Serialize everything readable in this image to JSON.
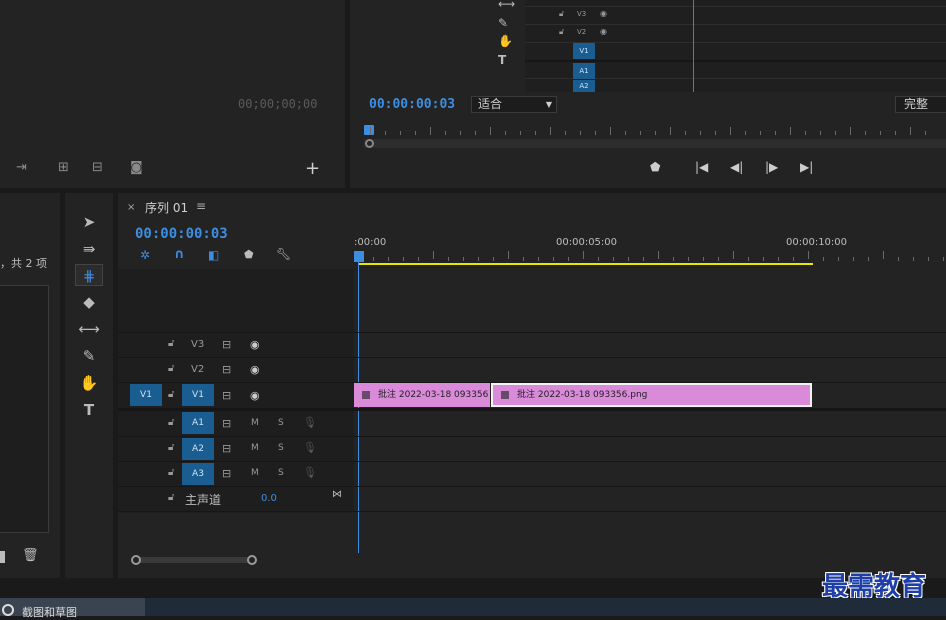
{
  "source": {
    "timecode": "00;00;00;00",
    "add_label": "+"
  },
  "program": {
    "timecode": "00:00:00:03",
    "fit_select": "适合",
    "quality_select": "完整",
    "mini_tracks": [
      "V3",
      "V2",
      "V1",
      "A1",
      "A2"
    ]
  },
  "project": {
    "count_text": "，共 2 项"
  },
  "timeline": {
    "close_symbol": "×",
    "sequence_name": "序列 01",
    "menu_symbol": "≡",
    "timecode": "00:00:00:03",
    "ruler_labels": [
      ":00:00",
      "00:00:05:00",
      "00:00:10:00"
    ],
    "source_patch": "V1",
    "video_tracks": [
      "V3",
      "V2",
      "V1"
    ],
    "audio_tracks": [
      "A1",
      "A2",
      "A3"
    ],
    "mute_label": "M",
    "solo_label": "S",
    "master_label": "主声道",
    "master_value": "0.0",
    "clips": [
      {
        "name": "批注 2022-03-18 093356"
      },
      {
        "name": "批注 2022-03-18  093356.png"
      }
    ]
  },
  "watermark": "最需教育",
  "taskbar": {
    "label": "截图和草图"
  },
  "colors": {
    "accent_blue": "#3d8ee0",
    "track_blue": "#1a5d91",
    "clip_pink": "#d98ad8",
    "work_area_yellow": "#e8e800",
    "watermark_blue": "#1f3fa8"
  }
}
